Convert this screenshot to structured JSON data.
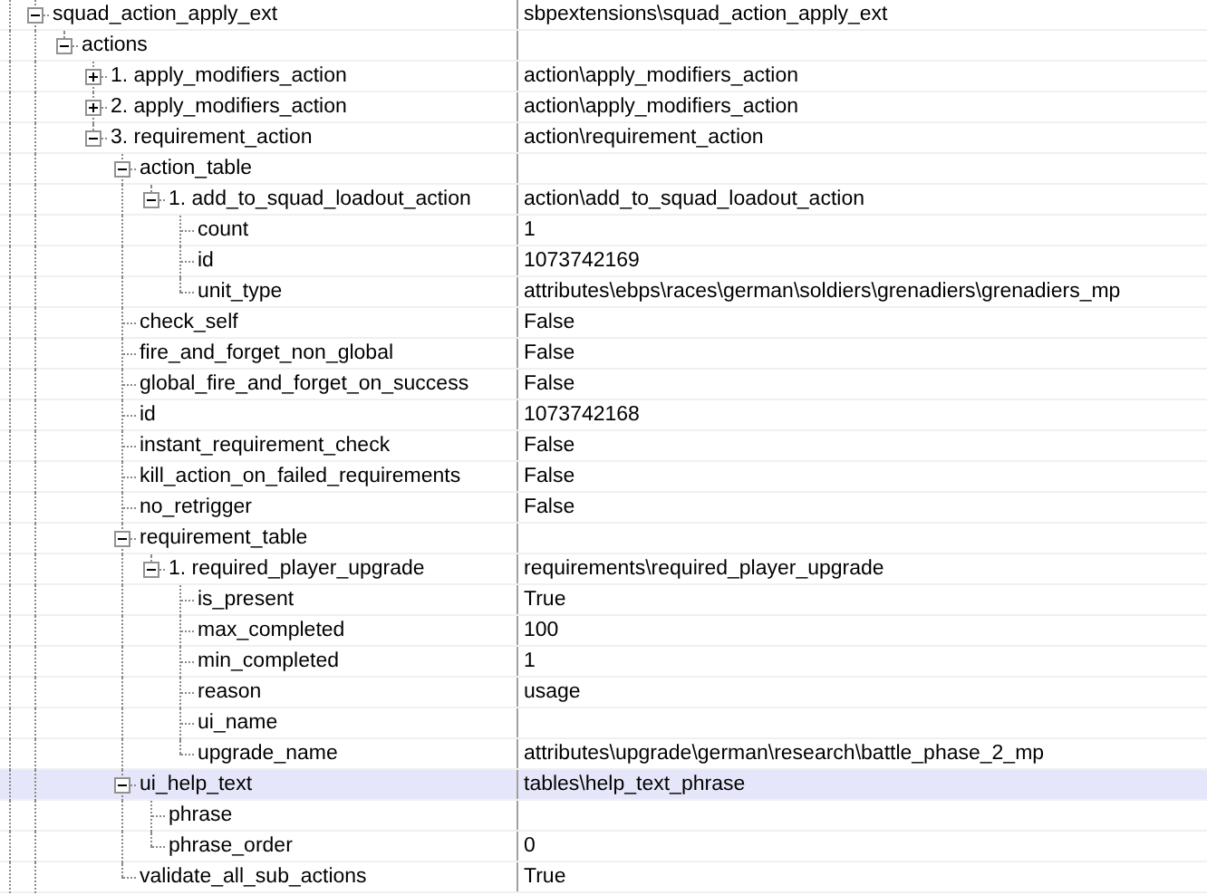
{
  "tree": [
    {
      "name": "squad_action_apply_ext",
      "value": "sbpextensions\\squad_action_apply_ext",
      "expanded": true,
      "selected": false,
      "children": [
        {
          "name": "actions",
          "expanded": true,
          "selected": false,
          "children": [
            {
              "name": "1. apply_modifiers_action",
              "value": "action\\apply_modifiers_action",
              "expanded": false,
              "selected": false
            },
            {
              "name": "2. apply_modifiers_action",
              "value": "action\\apply_modifiers_action",
              "expanded": false,
              "selected": false
            },
            {
              "name": "3. requirement_action",
              "value": "action\\requirement_action",
              "expanded": true,
              "selected": false,
              "children": [
                {
                  "name": "action_table",
                  "expanded": true,
                  "selected": false,
                  "children": [
                    {
                      "name": "1. add_to_squad_loadout_action",
                      "value": "action\\add_to_squad_loadout_action",
                      "expanded": true,
                      "selected": false,
                      "children": [
                        {
                          "name": "count",
                          "value": "1",
                          "selected": false
                        },
                        {
                          "name": "id",
                          "value": "1073742169",
                          "selected": false
                        },
                        {
                          "name": "unit_type",
                          "value": "attributes\\ebps\\races\\german\\soldiers\\grenadiers\\grenadiers_mp",
                          "selected": false
                        }
                      ]
                    }
                  ]
                },
                {
                  "name": "check_self",
                  "value": "False",
                  "selected": false
                },
                {
                  "name": "fire_and_forget_non_global",
                  "value": "False",
                  "selected": false
                },
                {
                  "name": "global_fire_and_forget_on_success",
                  "value": "False",
                  "selected": false
                },
                {
                  "name": "id",
                  "value": "1073742168",
                  "selected": false
                },
                {
                  "name": "instant_requirement_check",
                  "value": "False",
                  "selected": false
                },
                {
                  "name": "kill_action_on_failed_requirements",
                  "value": "False",
                  "selected": false
                },
                {
                  "name": "no_retrigger",
                  "value": "False",
                  "selected": false
                },
                {
                  "name": "requirement_table",
                  "expanded": true,
                  "selected": false,
                  "children": [
                    {
                      "name": "1. required_player_upgrade",
                      "value": "requirements\\required_player_upgrade",
                      "expanded": true,
                      "selected": false,
                      "children": [
                        {
                          "name": "is_present",
                          "value": "True",
                          "selected": false
                        },
                        {
                          "name": "max_completed",
                          "value": "100",
                          "selected": false
                        },
                        {
                          "name": "min_completed",
                          "value": "1",
                          "selected": false
                        },
                        {
                          "name": "reason",
                          "value": "usage",
                          "selected": false
                        },
                        {
                          "name": "ui_name",
                          "selected": false
                        },
                        {
                          "name": "upgrade_name",
                          "value": "attributes\\upgrade\\german\\research\\battle_phase_2_mp",
                          "selected": false
                        }
                      ]
                    }
                  ]
                },
                {
                  "name": "ui_help_text",
                  "value": "tables\\help_text_phrase",
                  "expanded": true,
                  "selected": true,
                  "children": [
                    {
                      "name": "phrase",
                      "selected": false
                    },
                    {
                      "name": "phrase_order",
                      "value": "0",
                      "selected": false
                    }
                  ]
                },
                {
                  "name": "validate_all_sub_actions",
                  "value": "True",
                  "selected": false
                }
              ]
            }
          ]
        }
      ]
    }
  ]
}
